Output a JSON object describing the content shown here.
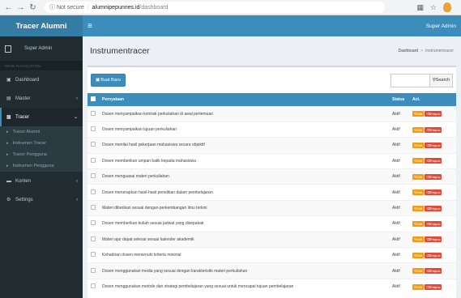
{
  "browser": {
    "security": "Not secure",
    "url_host": "alumnipepunnes.id",
    "url_path": "/dashboard"
  },
  "header": {
    "logo": "Tracer Alumni",
    "user": "Super Admin"
  },
  "sidebar": {
    "user_name": "Super Admin",
    "section": "MAIN NAVIGATION",
    "items": [
      {
        "label": "Dashboard"
      },
      {
        "label": "Master"
      },
      {
        "label": "Tracer"
      },
      {
        "label": "Konten"
      },
      {
        "label": "Settings"
      }
    ],
    "tracer_sub": [
      {
        "label": "Tracer Alumni"
      },
      {
        "label": "Instrumen Tracer"
      },
      {
        "label": "Tracer Pengguna"
      },
      {
        "label": "Instrumen Pengguna"
      }
    ]
  },
  "page": {
    "title": "Instrumentracer",
    "breadcrumb_home": "Dashboard",
    "breadcrumb_current": "Instrumentracer"
  },
  "toolbar": {
    "add_label": "Buat Baru",
    "search_label": "Search"
  },
  "table": {
    "headers": [
      "Pernyataan",
      "Status",
      "Act."
    ],
    "edit_label": "Edit",
    "delete_label": "Hapus",
    "rows": [
      {
        "statement": "Dosen menyampaikan kontrak perkuliahan di awal pertemuan",
        "status": "Aktif"
      },
      {
        "statement": "Dosen menyampaikan tujuan perkuliahan",
        "status": "Aktif"
      },
      {
        "statement": "Dosen menilai hasil pekerjaan mahasiswa secara objektif",
        "status": "Aktif"
      },
      {
        "statement": "Dosen memberikan umpan balik kepada mahasiswa",
        "status": "Aktif"
      },
      {
        "statement": "Dosen menguasai materi perkuliahan",
        "status": "Aktif"
      },
      {
        "statement": "Dosen menerapkan hasil-hasil penelitian dalam pembelajaran",
        "status": "Aktif"
      },
      {
        "statement": "Materi diberikan sesuai dengan perkembangan ilmu terkini",
        "status": "Aktif"
      },
      {
        "statement": "Dosen memberikan kuliah sesuai jadwal yang disepakati",
        "status": "Aktif"
      },
      {
        "statement": "Materi ajar dapat selesai sesuai kalender akademik",
        "status": "Aktif"
      },
      {
        "statement": "Kehadiran dosen memenuhi kriteria minimal",
        "status": "Aktif"
      },
      {
        "statement": "Dosen menggunakan media yang sesuai dengan karakteristik materi perkuliahan",
        "status": "Aktif"
      },
      {
        "statement": "Dosen menggunakan metode dan strategi pembelajaran yang sesuai untuk mencapai tujuan pembelajaran",
        "status": "Aktif"
      }
    ]
  },
  "colors": {
    "primary": "#3c8dbc",
    "logo_bg": "#357ca5",
    "sidebar_bg": "#222d32",
    "edit": "#f39c12",
    "delete": "#dd4b39"
  }
}
